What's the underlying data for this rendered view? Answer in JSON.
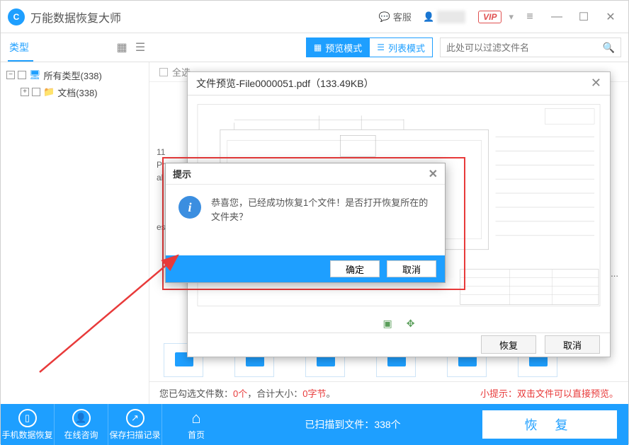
{
  "titlebar": {
    "app_title": "万能数据恢复大师",
    "kefu_label": "客服",
    "vip_label": "VIP"
  },
  "sidebar_header": {
    "title": "类型"
  },
  "tree": {
    "root_label": "所有类型(338)",
    "child_label": "文档(338)"
  },
  "toolbar": {
    "preview_mode": "预览模式",
    "list_mode": "列表模式",
    "filter_placeholder": "此处可以过滤文件名"
  },
  "select_all": {
    "label": "全选"
  },
  "left_fragments": {
    "l1": "11",
    "l2": "Pro",
    "l3": "al",
    "l4": "es"
  },
  "loading_text": ".命加载中...",
  "status_bar": {
    "prefix": "您已勾选文件数：",
    "count": "0个",
    "mid": "，合计大小：",
    "size": "0字节",
    "suffix": "。",
    "tip": "小提示：双击文件可以直接预览。"
  },
  "footer": {
    "phone": "手机数据恢复",
    "consult": "在线咨询",
    "save": "保存扫描记录",
    "home": "首页",
    "scan_prefix": "已扫描到文件：",
    "scan_count": "338个",
    "recover": "恢 复"
  },
  "preview": {
    "title": "文件预览-File0000051.pdf（133.49KB）",
    "ok": "恢复",
    "cancel": "取消"
  },
  "prompt": {
    "title": "提示",
    "message": "恭喜您，已经成功恢复1个文件！是否打开恢复所在的文件夹？",
    "ok": "确定",
    "cancel": "取消"
  }
}
